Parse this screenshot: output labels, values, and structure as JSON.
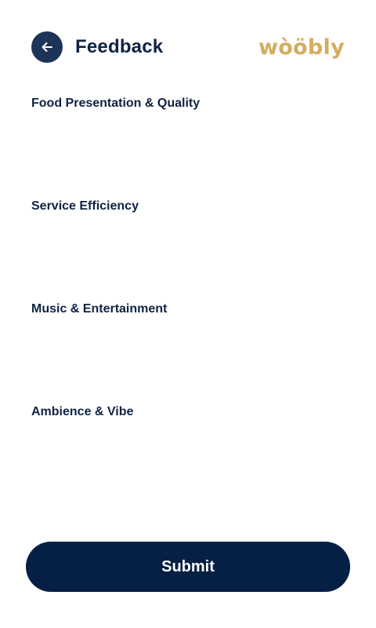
{
  "header": {
    "title": "Feedback",
    "brand": "wòöbly",
    "back_icon": "arrow-left-icon"
  },
  "sections": [
    {
      "label": "Food Presentation & Quality"
    },
    {
      "label": "Service Efficiency"
    },
    {
      "label": "Music & Entertainment"
    },
    {
      "label": "Ambience & Vibe"
    }
  ],
  "footer": {
    "submit_label": "Submit"
  },
  "colors": {
    "primary": "#061f44",
    "back_button": "#1e3358",
    "brand": "#d2ad5e",
    "text": "#0f2342",
    "background": "#ffffff"
  }
}
